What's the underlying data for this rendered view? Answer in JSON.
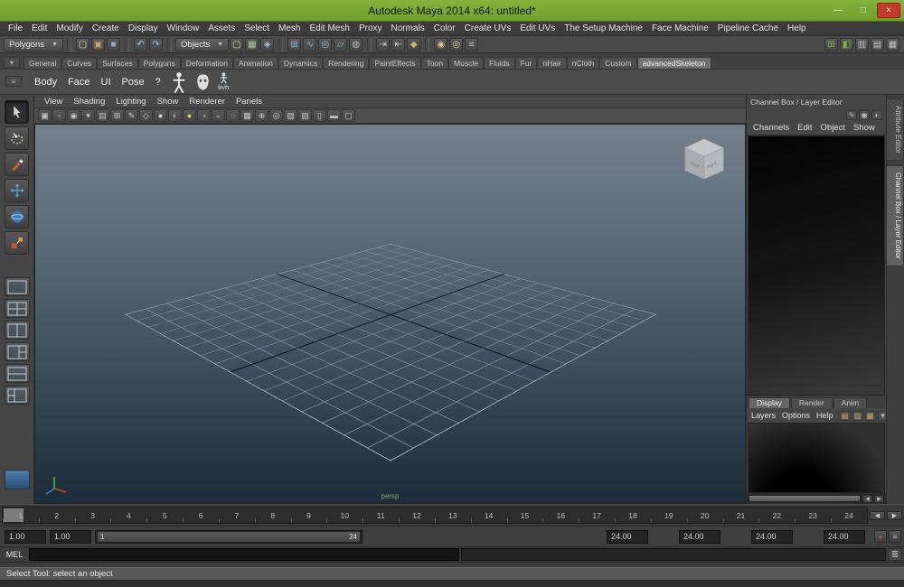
{
  "window": {
    "title": "Autodesk Maya 2014 x64: untitled*",
    "minimize_glyph": "—",
    "maximize_glyph": "□",
    "close_glyph": "×"
  },
  "menubar": {
    "items": [
      "File",
      "Edit",
      "Modify",
      "Create",
      "Display",
      "Window",
      "Assets",
      "Select",
      "Mesh",
      "Edit Mesh",
      "Proxy",
      "Normals",
      "Color",
      "Create UVs",
      "Edit UVs",
      "The Setup Machine",
      "Face Machine",
      "Pipeline Cache",
      "Help"
    ]
  },
  "statusline": {
    "menu_set": "Polygons",
    "selection_mask": "Objects",
    "file_icons": [
      {
        "name": "new-scene-icon",
        "glyph": "▢",
        "color": "#d2d2d2"
      },
      {
        "name": "open-scene-icon",
        "glyph": "▣",
        "color": "#c9a868"
      },
      {
        "name": "save-scene-icon",
        "glyph": "■",
        "color": "#93aac2"
      }
    ],
    "edit_icons": [
      {
        "name": "undo-icon",
        "glyph": "↶",
        "color": "#9ec7e8"
      },
      {
        "name": "redo-icon",
        "glyph": "↷",
        "color": "#9ec7e8"
      }
    ],
    "mask_icons": [
      {
        "name": "select-hierarchy-icon",
        "glyph": "▢",
        "color": "#cfcf9e"
      },
      {
        "name": "select-object-icon",
        "glyph": "▦",
        "color": "#a4cf9e"
      },
      {
        "name": "select-component-icon",
        "glyph": "◈",
        "color": "#9ebfd8"
      }
    ],
    "snap_icons": [
      {
        "name": "snap-grid-icon",
        "glyph": "⊞",
        "color": "#8cb4d2"
      },
      {
        "name": "snap-curve-icon",
        "glyph": "∿",
        "color": "#8cb4d2"
      },
      {
        "name": "snap-point-icon",
        "glyph": "◎",
        "color": "#8cb4d2"
      },
      {
        "name": "snap-plane-icon",
        "glyph": "▱",
        "color": "#8cb4d2"
      },
      {
        "name": "make-live-icon",
        "glyph": "◍",
        "color": "#a8c0a8"
      }
    ],
    "history_icons": [
      {
        "name": "input-to-selected-icon",
        "glyph": "⇥",
        "color": "#c8c8c8"
      },
      {
        "name": "output-from-selected-icon",
        "glyph": "⇤",
        "color": "#c8c8c8"
      },
      {
        "name": "construction-history-icon",
        "glyph": "◆",
        "color": "#c8b078"
      }
    ],
    "render_icons": [
      {
        "name": "render-current-frame-icon",
        "glyph": "◉",
        "color": "#d8c698"
      },
      {
        "name": "ipr-render-icon",
        "glyph": "◎",
        "color": "#d8c698"
      },
      {
        "name": "render-settings-icon",
        "glyph": "≡",
        "color": "#c8c8c8"
      }
    ],
    "sidebar_icons": [
      {
        "name": "grid-toggle-icon",
        "glyph": "⊞",
        "color": "#7cb342"
      },
      {
        "name": "snap-together-icon",
        "glyph": "◧",
        "color": "#7cb342"
      },
      {
        "name": "attribute-editor-toggle-icon",
        "glyph": "▥",
        "color": "#c2c2c2"
      },
      {
        "name": "tool-settings-toggle-icon",
        "glyph": "▤",
        "color": "#c2c2c2"
      },
      {
        "name": "channel-box-toggle-icon",
        "glyph": "▦",
        "color": "#c2c2c2"
      }
    ]
  },
  "shelf": {
    "gutter_icons": [
      {
        "name": "shelf-tab-switch-icon",
        "glyph": "▾"
      },
      {
        "name": "shelf-menu-icon",
        "glyph": "≡"
      }
    ],
    "tabs": [
      {
        "label": "General"
      },
      {
        "label": "Curves"
      },
      {
        "label": "Surfaces"
      },
      {
        "label": "Polygons"
      },
      {
        "label": "Deformation"
      },
      {
        "label": "Animation"
      },
      {
        "label": "Dynamics"
      },
      {
        "label": "Rendering"
      },
      {
        "label": "PaintEffects"
      },
      {
        "label": "Toon"
      },
      {
        "label": "Muscle"
      },
      {
        "label": "Fluids"
      },
      {
        "label": "Fur"
      },
      {
        "label": "nHair"
      },
      {
        "label": "nCloth"
      },
      {
        "label": "Custom"
      },
      {
        "label": "advancedSkeleton",
        "active": true
      }
    ],
    "buttons": [
      "Body",
      "Face",
      "UI",
      "Pose",
      "?"
    ],
    "bvh_label": "bvh"
  },
  "toolbox": {
    "tools": [
      "select-tool",
      "lasso-tool",
      "paint-select-tool",
      "move-tool",
      "rotate-tool",
      "scale-tool"
    ],
    "active": "select-tool"
  },
  "panel": {
    "menus": [
      "View",
      "Shading",
      "Lighting",
      "Show",
      "Renderer",
      "Panels"
    ],
    "toolbar_icons": [
      {
        "name": "select-camera-icon",
        "glyph": "▣"
      },
      {
        "name": "lock-camera-icon",
        "glyph": "▫"
      },
      {
        "name": "camera-attributes-icon",
        "glyph": "◉"
      },
      {
        "name": "bookmarks-icon",
        "glyph": "▾"
      },
      {
        "name": "image-plane-icon",
        "glyph": "▤"
      },
      {
        "name": "two-d-pan-zoom-icon",
        "glyph": "⊞"
      },
      {
        "name": "grease-pencil-icon",
        "glyph": "✎"
      },
      {
        "name": "wireframe-icon",
        "glyph": "◇"
      },
      {
        "name": "smooth-shade-icon",
        "glyph": "●",
        "color": "#d2d2d2"
      },
      {
        "name": "textured-icon",
        "glyph": "◐",
        "color": "#c8b87a"
      },
      {
        "name": "use-all-lights-icon",
        "glyph": "●",
        "color": "#d8d05c"
      },
      {
        "name": "shadows-icon",
        "glyph": "◑",
        "color": "#9a9a9a"
      },
      {
        "name": "screen-space-ao-icon",
        "glyph": "◒",
        "color": "#9a9a9a"
      },
      {
        "name": "motion-blur-icon",
        "glyph": "◌"
      },
      {
        "name": "multisample-icon",
        "glyph": "▦"
      },
      {
        "name": "sequence-time-icon",
        "glyph": "⊕"
      },
      {
        "name": "isolate-select-icon",
        "glyph": "◎"
      },
      {
        "name": "xray-icon",
        "glyph": "▨"
      },
      {
        "name": "xray-joints-icon",
        "glyph": "▧"
      },
      {
        "name": "resolution-gate-icon",
        "glyph": "▯"
      },
      {
        "name": "gate-mask-icon",
        "glyph": "▬"
      },
      {
        "name": "film-gate-icon",
        "glyph": "▢"
      }
    ],
    "camera_label": "persp",
    "viewcube": {
      "front": "front",
      "right": "right"
    }
  },
  "channel_box": {
    "title": "Channel Box / Layer Editor",
    "title_icons": [
      {
        "name": "pin-icon",
        "glyph": "✛"
      },
      {
        "name": "collapse-icon",
        "glyph": "▾"
      }
    ],
    "toolbar_icons": [
      {
        "name": "manip-default-icon",
        "glyph": "✎"
      },
      {
        "name": "speed-controls-icon",
        "glyph": "◉"
      },
      {
        "name": "hyperbolic-icon",
        "glyph": "◐"
      }
    ],
    "menus": [
      "Channels",
      "Edit",
      "Object",
      "Show"
    ]
  },
  "edge_tabs": [
    {
      "label": "Attribute Editor"
    },
    {
      "label": "Channel Box / Layer Editor",
      "active": true
    }
  ],
  "layer_editor": {
    "tabs": [
      {
        "label": "Display",
        "active": true
      },
      {
        "label": "Render"
      },
      {
        "label": "Anim"
      }
    ],
    "menus": [
      "Layers",
      "Options",
      "Help"
    ],
    "icons": [
      {
        "name": "new-empty-layer-icon",
        "glyph": "▤",
        "color": "#c8aa6e"
      },
      {
        "name": "new-layer-from-selected-icon",
        "glyph": "▥",
        "color": "#c8aa6e"
      },
      {
        "name": "new-render-layer-icon",
        "glyph": "▦",
        "color": "#c8aa6e"
      },
      {
        "name": "layer-sort-icon",
        "glyph": "▼",
        "color": "#b0b0b0"
      }
    ],
    "scroll": {
      "left": "◀",
      "right": "▶"
    }
  },
  "timeline": {
    "frames": [
      "1",
      "2",
      "3",
      "4",
      "5",
      "6",
      "7",
      "8",
      "9",
      "10",
      "11",
      "12",
      "13",
      "14",
      "15",
      "16",
      "17",
      "18",
      "19",
      "20",
      "21",
      "22",
      "23",
      "24"
    ],
    "current_frame": "1",
    "transport": [
      {
        "name": "step-back-button",
        "glyph": "◀"
      },
      {
        "name": "step-forward-button",
        "glyph": "▶"
      }
    ]
  },
  "range_slider": {
    "left_fields": [
      {
        "name": "animation-start-field",
        "value": "1.00"
      },
      {
        "name": "playback-start-field",
        "value": "1.00"
      }
    ],
    "handle_start": "1",
    "handle_end": "24",
    "right_fields": [
      {
        "name": "playback-end-field",
        "value": "24.00"
      },
      {
        "name": "animation-end-field",
        "value": "24.00"
      },
      {
        "name": "playback-end-field-2",
        "value": "24.00"
      },
      {
        "name": "animation-end-field-2",
        "value": "24.00"
      }
    ],
    "buttons": [
      {
        "name": "auto-keyframe-button",
        "glyph": "●",
        "color": "#b2423a"
      },
      {
        "name": "animation-preferences-button",
        "glyph": "≡",
        "color": "#c0c0c0"
      }
    ]
  },
  "command_line": {
    "label": "MEL",
    "input_value": "",
    "icon": {
      "name": "script-editor-icon",
      "glyph": "≣"
    }
  },
  "help_line": {
    "text": "Select Tool: select an object"
  }
}
